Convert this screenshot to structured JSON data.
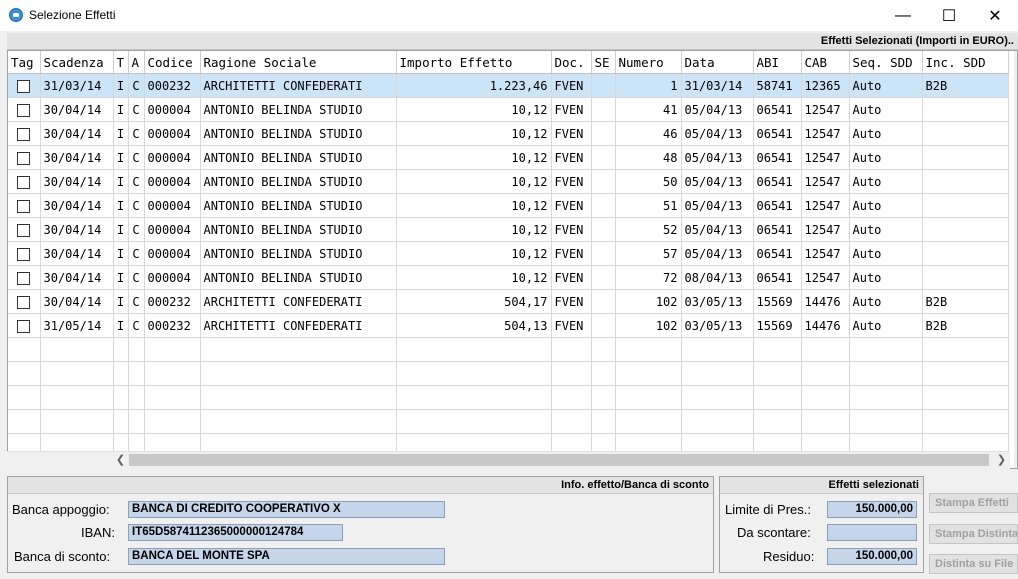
{
  "window": {
    "title": "Selezione Effetti",
    "minimize": "—",
    "maximize": "☐",
    "close": "✕"
  },
  "grid": {
    "header_caption": "Effetti Selezionati  (Importi in EURO)..",
    "columns": [
      "Tag",
      "Scadenza",
      "T",
      "A",
      "Codice",
      "Ragione Sociale",
      "Importo Effetto",
      "Doc.",
      "SE",
      "Numero",
      "Data",
      "ABI",
      "CAB",
      "Seq. SDD",
      "Inc. SDD"
    ],
    "rows": [
      {
        "scadenza": "31/03/14",
        "t": "I",
        "a": "C",
        "codice": "000232",
        "ragione": "ARCHITETTI CONFEDERATI",
        "importo": "1.223,46",
        "doc": "FVEN",
        "se": "",
        "numero": "1",
        "data": "31/03/14",
        "abi": "58741",
        "cab": "12365",
        "seq": "Auto",
        "inc": "B2B"
      },
      {
        "scadenza": "30/04/14",
        "t": "I",
        "a": "C",
        "codice": "000004",
        "ragione": "ANTONIO BELINDA STUDIO",
        "importo": "10,12",
        "doc": "FVEN",
        "se": "",
        "numero": "41",
        "data": "05/04/13",
        "abi": "06541",
        "cab": "12547",
        "seq": "Auto",
        "inc": ""
      },
      {
        "scadenza": "30/04/14",
        "t": "I",
        "a": "C",
        "codice": "000004",
        "ragione": "ANTONIO BELINDA STUDIO",
        "importo": "10,12",
        "doc": "FVEN",
        "se": "",
        "numero": "46",
        "data": "05/04/13",
        "abi": "06541",
        "cab": "12547",
        "seq": "Auto",
        "inc": ""
      },
      {
        "scadenza": "30/04/14",
        "t": "I",
        "a": "C",
        "codice": "000004",
        "ragione": "ANTONIO BELINDA STUDIO",
        "importo": "10,12",
        "doc": "FVEN",
        "se": "",
        "numero": "48",
        "data": "05/04/13",
        "abi": "06541",
        "cab": "12547",
        "seq": "Auto",
        "inc": ""
      },
      {
        "scadenza": "30/04/14",
        "t": "I",
        "a": "C",
        "codice": "000004",
        "ragione": "ANTONIO BELINDA STUDIO",
        "importo": "10,12",
        "doc": "FVEN",
        "se": "",
        "numero": "50",
        "data": "05/04/13",
        "abi": "06541",
        "cab": "12547",
        "seq": "Auto",
        "inc": ""
      },
      {
        "scadenza": "30/04/14",
        "t": "I",
        "a": "C",
        "codice": "000004",
        "ragione": "ANTONIO BELINDA STUDIO",
        "importo": "10,12",
        "doc": "FVEN",
        "se": "",
        "numero": "51",
        "data": "05/04/13",
        "abi": "06541",
        "cab": "12547",
        "seq": "Auto",
        "inc": ""
      },
      {
        "scadenza": "30/04/14",
        "t": "I",
        "a": "C",
        "codice": "000004",
        "ragione": "ANTONIO BELINDA STUDIO",
        "importo": "10,12",
        "doc": "FVEN",
        "se": "",
        "numero": "52",
        "data": "05/04/13",
        "abi": "06541",
        "cab": "12547",
        "seq": "Auto",
        "inc": ""
      },
      {
        "scadenza": "30/04/14",
        "t": "I",
        "a": "C",
        "codice": "000004",
        "ragione": "ANTONIO BELINDA STUDIO",
        "importo": "10,12",
        "doc": "FVEN",
        "se": "",
        "numero": "57",
        "data": "05/04/13",
        "abi": "06541",
        "cab": "12547",
        "seq": "Auto",
        "inc": ""
      },
      {
        "scadenza": "30/04/14",
        "t": "I",
        "a": "C",
        "codice": "000004",
        "ragione": "ANTONIO BELINDA STUDIO",
        "importo": "10,12",
        "doc": "FVEN",
        "se": "",
        "numero": "72",
        "data": "08/04/13",
        "abi": "06541",
        "cab": "12547",
        "seq": "Auto",
        "inc": ""
      },
      {
        "scadenza": "30/04/14",
        "t": "I",
        "a": "C",
        "codice": "000232",
        "ragione": "ARCHITETTI CONFEDERATI",
        "importo": "504,17",
        "doc": "FVEN",
        "se": "",
        "numero": "102",
        "data": "03/05/13",
        "abi": "15569",
        "cab": "14476",
        "seq": "Auto",
        "inc": "B2B"
      },
      {
        "scadenza": "31/05/14",
        "t": "I",
        "a": "C",
        "codice": "000232",
        "ragione": "ARCHITETTI CONFEDERATI",
        "importo": "504,13",
        "doc": "FVEN",
        "se": "",
        "numero": "102",
        "data": "03/05/13",
        "abi": "15569",
        "cab": "14476",
        "seq": "Auto",
        "inc": "B2B"
      }
    ]
  },
  "info": {
    "header": "Info. effetto/Banca di sconto",
    "banca_appoggio_label": "Banca appoggio:",
    "banca_appoggio": "BANCA DI CREDITO COOPERATIVO X",
    "iban_label": "IBAN:",
    "iban": "IT65D5874112365000000124784",
    "banca_sconto_label": "Banca di sconto:",
    "banca_sconto": "BANCA DEL MONTE SPA"
  },
  "selezionati": {
    "header": "Effetti selezionati",
    "limite_label": "Limite di Pres.:",
    "limite": "150.000,00",
    "scontare_label": "Da scontare:",
    "scontare": "",
    "residuo_label": "Residuo:",
    "residuo": "150.000,00"
  },
  "buttons": {
    "stampa_effetti": "Stampa Effetti",
    "stampa_distinta": "Stampa Distinta",
    "distinta_file": "Distinta su File"
  }
}
